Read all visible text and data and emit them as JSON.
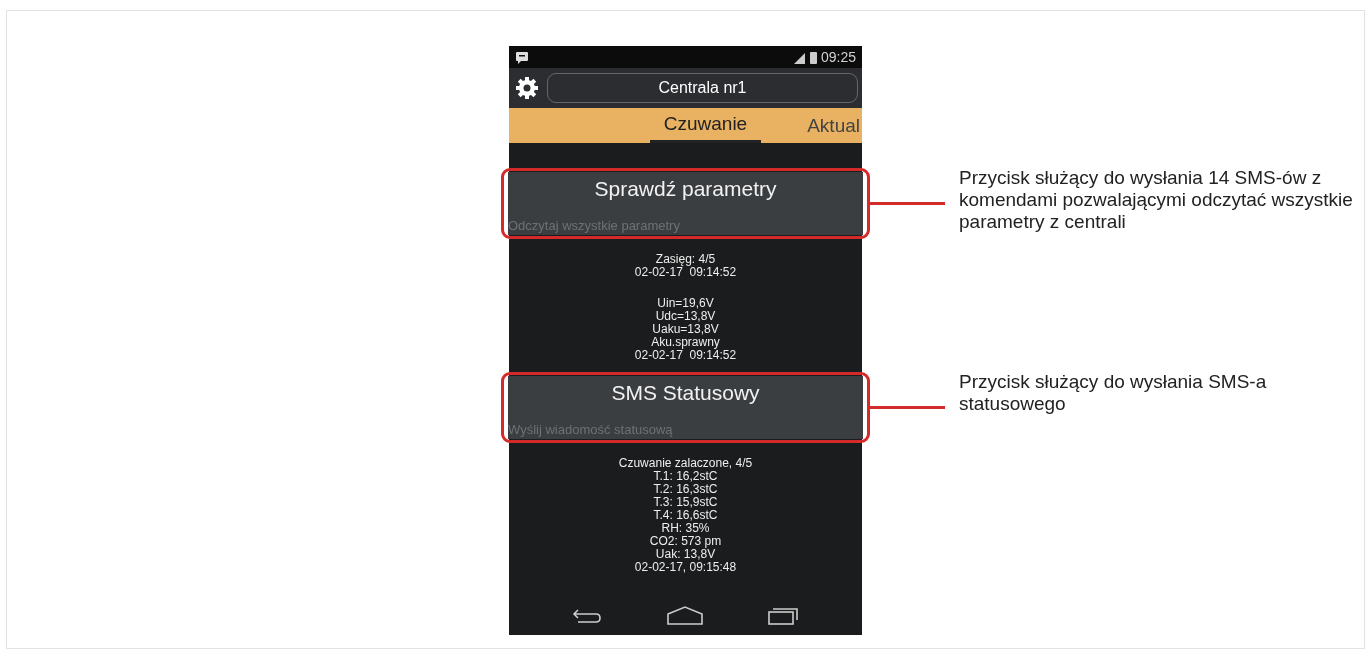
{
  "status_bar": {
    "time": "09:25"
  },
  "header": {
    "device": "Centrala nr1"
  },
  "tabs": [
    {
      "label": "Czuwanie",
      "selected": true
    },
    {
      "label": "Aktual",
      "selected": false
    }
  ],
  "sections": [
    {
      "kind": "button",
      "title": "Sprawdź parametry",
      "subtitle": "Odczytaj wszystkie parametry",
      "note": "Przycisk służący do wysłania 14 SMS-ów z komendami pozwalającymi odczytać wszystkie parametry z centrali"
    },
    {
      "kind": "readout",
      "lines": [
        "Zasięg: 4/5",
        "02-02-17  09:14:52"
      ]
    },
    {
      "kind": "readout",
      "lines": [
        "Uin=19,6V",
        "Udc=13,8V",
        "Uaku=13,8V",
        "Aku.sprawny",
        "02-02-17  09:14:52"
      ]
    },
    {
      "kind": "button",
      "title": "SMS Statusowy",
      "subtitle": "Wyślij wiadomość statusową",
      "note": "Przycisk służący do wysłania SMS-a statusowego"
    },
    {
      "kind": "readout",
      "lines": [
        "Czuwanie zalaczone, 4/5",
        "T.1: 16,2stC",
        "T.2: 16,3stC",
        "T.3: 15,9stC",
        "T.4: 16,6stC",
        "RH: 35%",
        "CO2: 573 pm",
        "Uak: 13,8V",
        "02-02-17, 09:15:48"
      ]
    }
  ]
}
